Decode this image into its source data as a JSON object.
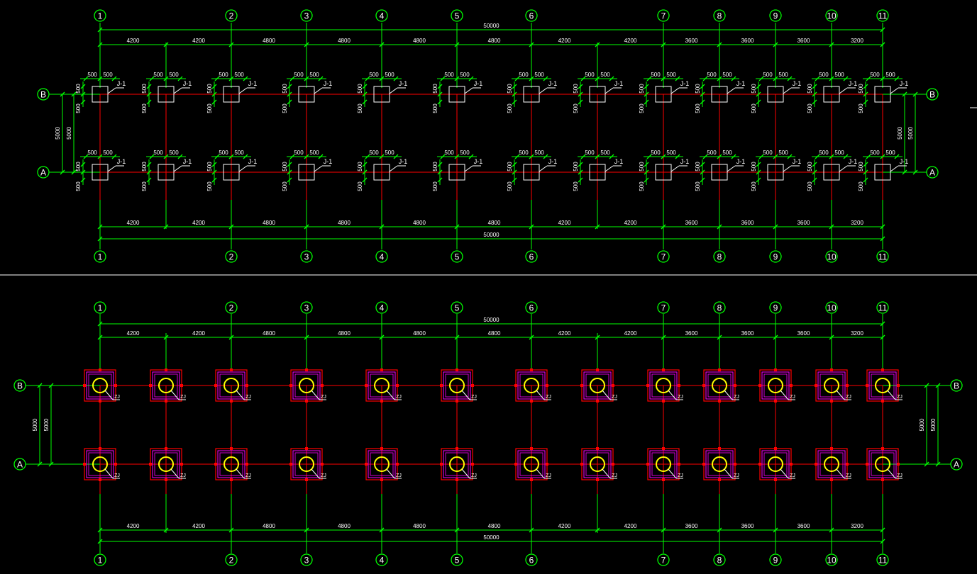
{
  "colors": {
    "background": "#000000",
    "dimension": "#00ff00",
    "axis_line": "#ff0000",
    "column": "#ffffff",
    "bubble_text": "#ffffff",
    "pile_circle": "#ffff00",
    "cap_outline": "#ff00ff",
    "cap_rebar": "#ff0000",
    "separator": "#ffffff",
    "label_text": "#ffffff"
  },
  "axes_x": [
    "1",
    "2",
    "3",
    "4",
    "5",
    "6",
    "7",
    "8",
    "9",
    "10",
    "11"
  ],
  "axes_y": [
    "B",
    "A"
  ],
  "spans_x": [
    "4200",
    "4200",
    "4800",
    "4800",
    "4800",
    "4800",
    "4200",
    "4200",
    "3600",
    "3600",
    "3600",
    "3200"
  ],
  "total_x": "50000",
  "span_y": "5000",
  "column_dim": "500",
  "column_tag": "J-1",
  "pile_tag": "ZJ"
}
